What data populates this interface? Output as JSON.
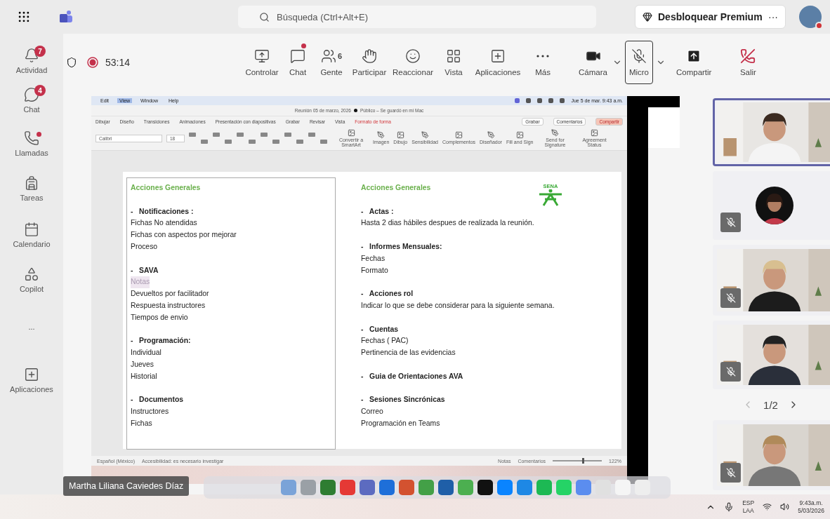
{
  "top_bar": {
    "search": {
      "placeholder": "Búsqueda (Ctrl+Alt+E)"
    },
    "premium_button": "Desbloquear Premium",
    "more": "···"
  },
  "rail": [
    {
      "label": "Actividad",
      "kind": "bell",
      "badge": "7",
      "dot": false
    },
    {
      "label": "Chat",
      "kind": "chat",
      "badge": "4",
      "dot": false
    },
    {
      "label": "Llamadas",
      "kind": "phone",
      "dot": true
    },
    {
      "label": "Tareas",
      "kind": "backpack",
      "dot": false
    },
    {
      "label": "Calendario",
      "kind": "calendar",
      "dot": false
    },
    {
      "label": "Copilot",
      "kind": "copilot",
      "dot": false
    },
    {
      "label": "...",
      "kind": "more",
      "dot": false
    },
    {
      "label": "Aplicaciones",
      "kind": "plus",
      "dot": false
    }
  ],
  "meeting": {
    "timer": "53:14",
    "recording": true,
    "controls": [
      {
        "label": "Controlar",
        "kind": "screen",
        "dot": false,
        "menu": false
      },
      {
        "label": "Chat",
        "kind": "chat",
        "dot": true,
        "menu": false
      },
      {
        "label": "Gente",
        "kind": "people",
        "count": "6",
        "dot": false,
        "menu": false
      },
      {
        "label": "Participar",
        "kind": "hand",
        "dot": false,
        "menu": false
      },
      {
        "label": "Reaccionar",
        "kind": "smile",
        "dot": false,
        "menu": false
      },
      {
        "label": "Vista",
        "kind": "grid",
        "dot": false,
        "menu": false
      },
      {
        "label": "Aplicaciones",
        "kind": "apps",
        "dot": false,
        "menu": false
      },
      {
        "label": "Más",
        "kind": "more",
        "dot": false,
        "menu": false
      },
      {
        "label": "Cámara",
        "kind": "camera",
        "on": true,
        "dot": false,
        "menu": true
      },
      {
        "label": "Micro",
        "kind": "mic",
        "on": false,
        "focused": true,
        "dot": false,
        "menu": true
      },
      {
        "label": "Compartir",
        "kind": "share",
        "dot": false,
        "menu": false
      },
      {
        "label": "Salir",
        "kind": "leave",
        "dot": false,
        "menu": false
      }
    ]
  },
  "shared_screen": {
    "mac_menu": [
      {
        "label": "Edit",
        "selected": false
      },
      {
        "label": "View",
        "selected": true
      },
      {
        "label": "Window",
        "selected": false
      },
      {
        "label": "Help",
        "selected": false
      }
    ],
    "mac_clock": "Jue 5 de mar. 9:43 a.m.",
    "document_title": "Reunión 05 de marzo, 2026",
    "document_status": "Público – Se guardó en mi Mac",
    "ribbon_tabs": [
      {
        "label": "Dibujar",
        "contextual": false
      },
      {
        "label": "Diseño",
        "contextual": false
      },
      {
        "label": "Transiciones",
        "contextual": false
      },
      {
        "label": "Animaciones",
        "contextual": false
      },
      {
        "label": "Presentación con diapositivas",
        "contextual": false
      },
      {
        "label": "Grabar",
        "contextual": false
      },
      {
        "label": "Revisar",
        "contextual": false
      },
      {
        "label": "Vista",
        "contextual": false
      },
      {
        "label": "Formato de forma",
        "contextual": true
      }
    ],
    "ribbon_buttons": [
      "Grabar",
      "Comentarios",
      "Compartir"
    ],
    "font": "Calibri",
    "font_size": "18",
    "ribbon_tools": [
      "Convertir a SmartArt",
      "Imagen",
      "Dibujo",
      "Sensibilidad",
      "Complementos",
      "Diseñador",
      "Fill and Sign",
      "Send for Signature",
      "Agreement Status"
    ],
    "slide": {
      "logo": "SENA",
      "columns": [
        {
          "selected": true,
          "heading": "Acciones Generales",
          "sections": [
            {
              "bullet": "-",
              "title": "Notificaciones :",
              "items": [
                {
                  "text": "Fichas No atendidas",
                  "highlighted": false
                },
                {
                  "text": "Fichas con aspectos por mejorar",
                  "highlighted": false
                },
                {
                  "text": "Proceso",
                  "highlighted": false
                }
              ]
            },
            {
              "bullet": "-",
              "title": "SAVA",
              "items": [
                {
                  "text": "Notas",
                  "highlighted": true
                },
                {
                  "text": "Devueltos por facilitador",
                  "highlighted": false
                },
                {
                  "text": "Respuesta instructores",
                  "highlighted": false
                },
                {
                  "text": "Tiempos de envio",
                  "highlighted": false
                }
              ]
            },
            {
              "bullet": "-",
              "title": "Programación:",
              "items": [
                {
                  "text": "Individual",
                  "highlighted": false
                },
                {
                  "text": "Jueves",
                  "highlighted": false
                },
                {
                  "text": "Historial",
                  "highlighted": false
                }
              ]
            },
            {
              "bullet": "-",
              "title": "Documentos",
              "items": [
                {
                  "text": "Instructores",
                  "highlighted": false
                },
                {
                  "text": "Fichas",
                  "highlighted": false
                }
              ]
            }
          ]
        },
        {
          "selected": false,
          "heading": "Acciones Generales",
          "sections": [
            {
              "bullet": "-",
              "title": "Actas :",
              "items": [
                {
                  "text": "Hasta 2 dias hábiles despues de realizada la reunión.",
                  "highlighted": false
                }
              ]
            },
            {
              "bullet": "-",
              "title": "Informes Mensuales:",
              "items": [
                {
                  "text": "Fechas",
                  "highlighted": false
                },
                {
                  "text": "Formato",
                  "highlighted": false
                }
              ]
            },
            {
              "bullet": "-",
              "title": "Acciones rol",
              "items": [
                {
                  "text": "Indicar lo que se debe considerar para la siguiente semana.",
                  "highlighted": false
                }
              ]
            },
            {
              "bullet": "-",
              "title": "Cuentas",
              "items": [
                {
                  "text": "Fechas  ( PAC)",
                  "highlighted": false
                },
                {
                  "text": "Pertinencia de las evidencias",
                  "highlighted": false
                }
              ]
            },
            {
              "bullet": "-",
              "title": "Guia de Orientaciones AVA"
            },
            {
              "bullet": "-",
              "title": "Sesiones Sincrónicas",
              "items": [
                {
                  "text": "Correo",
                  "highlighted": false
                },
                {
                  "text": "Programación en Teams",
                  "highlighted": false
                }
              ]
            }
          ]
        }
      ]
    },
    "status_bar": {
      "language": "Español (México)",
      "accessibility": "Accesibilidad: es necesario investigar",
      "notes": "Notas",
      "comments": "Comentarios",
      "zoom_slider": {
        "level": 0.6
      },
      "zoom": "122%"
    }
  },
  "presenter_name": "Martha Liliana Caviedes Díaz",
  "participants": [
    {
      "kind": "video",
      "selected": true,
      "muted": false
    },
    {
      "kind": "avatar",
      "selected": false,
      "muted": true
    },
    {
      "kind": "video",
      "selected": false,
      "muted": true
    },
    {
      "kind": "video",
      "selected": false,
      "muted": true
    },
    {
      "kind": "pager",
      "label": "1/2"
    },
    {
      "kind": "video",
      "selected": false,
      "muted": true
    }
  ],
  "taskbar": {
    "language": "ESP",
    "layout": "LAA",
    "time": "9:43a.m.",
    "date": "5/03/2026"
  }
}
